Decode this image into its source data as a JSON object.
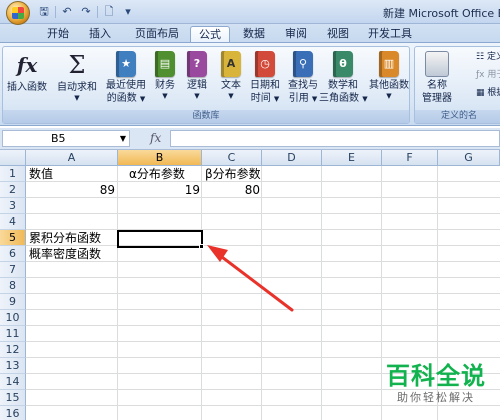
{
  "window": {
    "title": "新建 Microsoft Office Ex"
  },
  "quick_access": [
    {
      "icon": "save-icon",
      "glyph": "🖫"
    },
    {
      "icon": "undo-icon",
      "glyph": "↶"
    },
    {
      "icon": "redo-icon",
      "glyph": "↷"
    },
    {
      "icon": "print-preview-icon",
      "glyph": "🗋"
    },
    {
      "icon": "customize-icon",
      "glyph": "▾"
    }
  ],
  "tabs": [
    "开始",
    "插入",
    "页面布局",
    "公式",
    "数据",
    "审阅",
    "视图",
    "开发工具"
  ],
  "active_tab": "公式",
  "ribbon": {
    "group_label": "函数库",
    "group2_label": "定义的名",
    "insert_function": "插入函数",
    "autosum": [
      "自动求和"
    ],
    "recent": [
      "最近使用",
      "的函数"
    ],
    "financial": "财务",
    "logical": "逻辑",
    "text": "文本",
    "datetime": [
      "日期和",
      "时间"
    ],
    "lookup": [
      "查找与",
      "引用"
    ],
    "math": [
      "数学和",
      "三角函数"
    ],
    "more": "其他函数",
    "name_manager": [
      "名称",
      "管理器"
    ],
    "define_name": "定义名",
    "use_in_formula": "用于公",
    "create_from_sel": "根据所",
    "colors": {
      "financial": "#4f8f2f",
      "logical": "#9a4a9e",
      "text": "#d9b43a",
      "datetime": "#d24a3a",
      "lookup": "#3a6fb8",
      "math": "#3a8a6a",
      "more": "#d9892a"
    }
  },
  "formula_bar": {
    "cell_ref": "B5",
    "formula": ""
  },
  "columns": [
    "A",
    "B",
    "C",
    "D",
    "E",
    "F",
    "G"
  ],
  "selected_column": "B",
  "rows": [
    "1",
    "2",
    "3",
    "4",
    "5",
    "6",
    "7",
    "8",
    "9",
    "10",
    "11",
    "12",
    "13",
    "14",
    "15",
    "16"
  ],
  "selected_row": "5",
  "cells": {
    "A1": "数值",
    "B1": "α分布参数",
    "C1": "β分布参数",
    "A2": "89",
    "B2": "19",
    "C2": "80",
    "A5": "累积分布函数",
    "A6": "概率密度函数"
  },
  "watermark": {
    "title": "百科全说",
    "subtitle": "助你轻松解决"
  },
  "annotation_color": "#e8322a"
}
